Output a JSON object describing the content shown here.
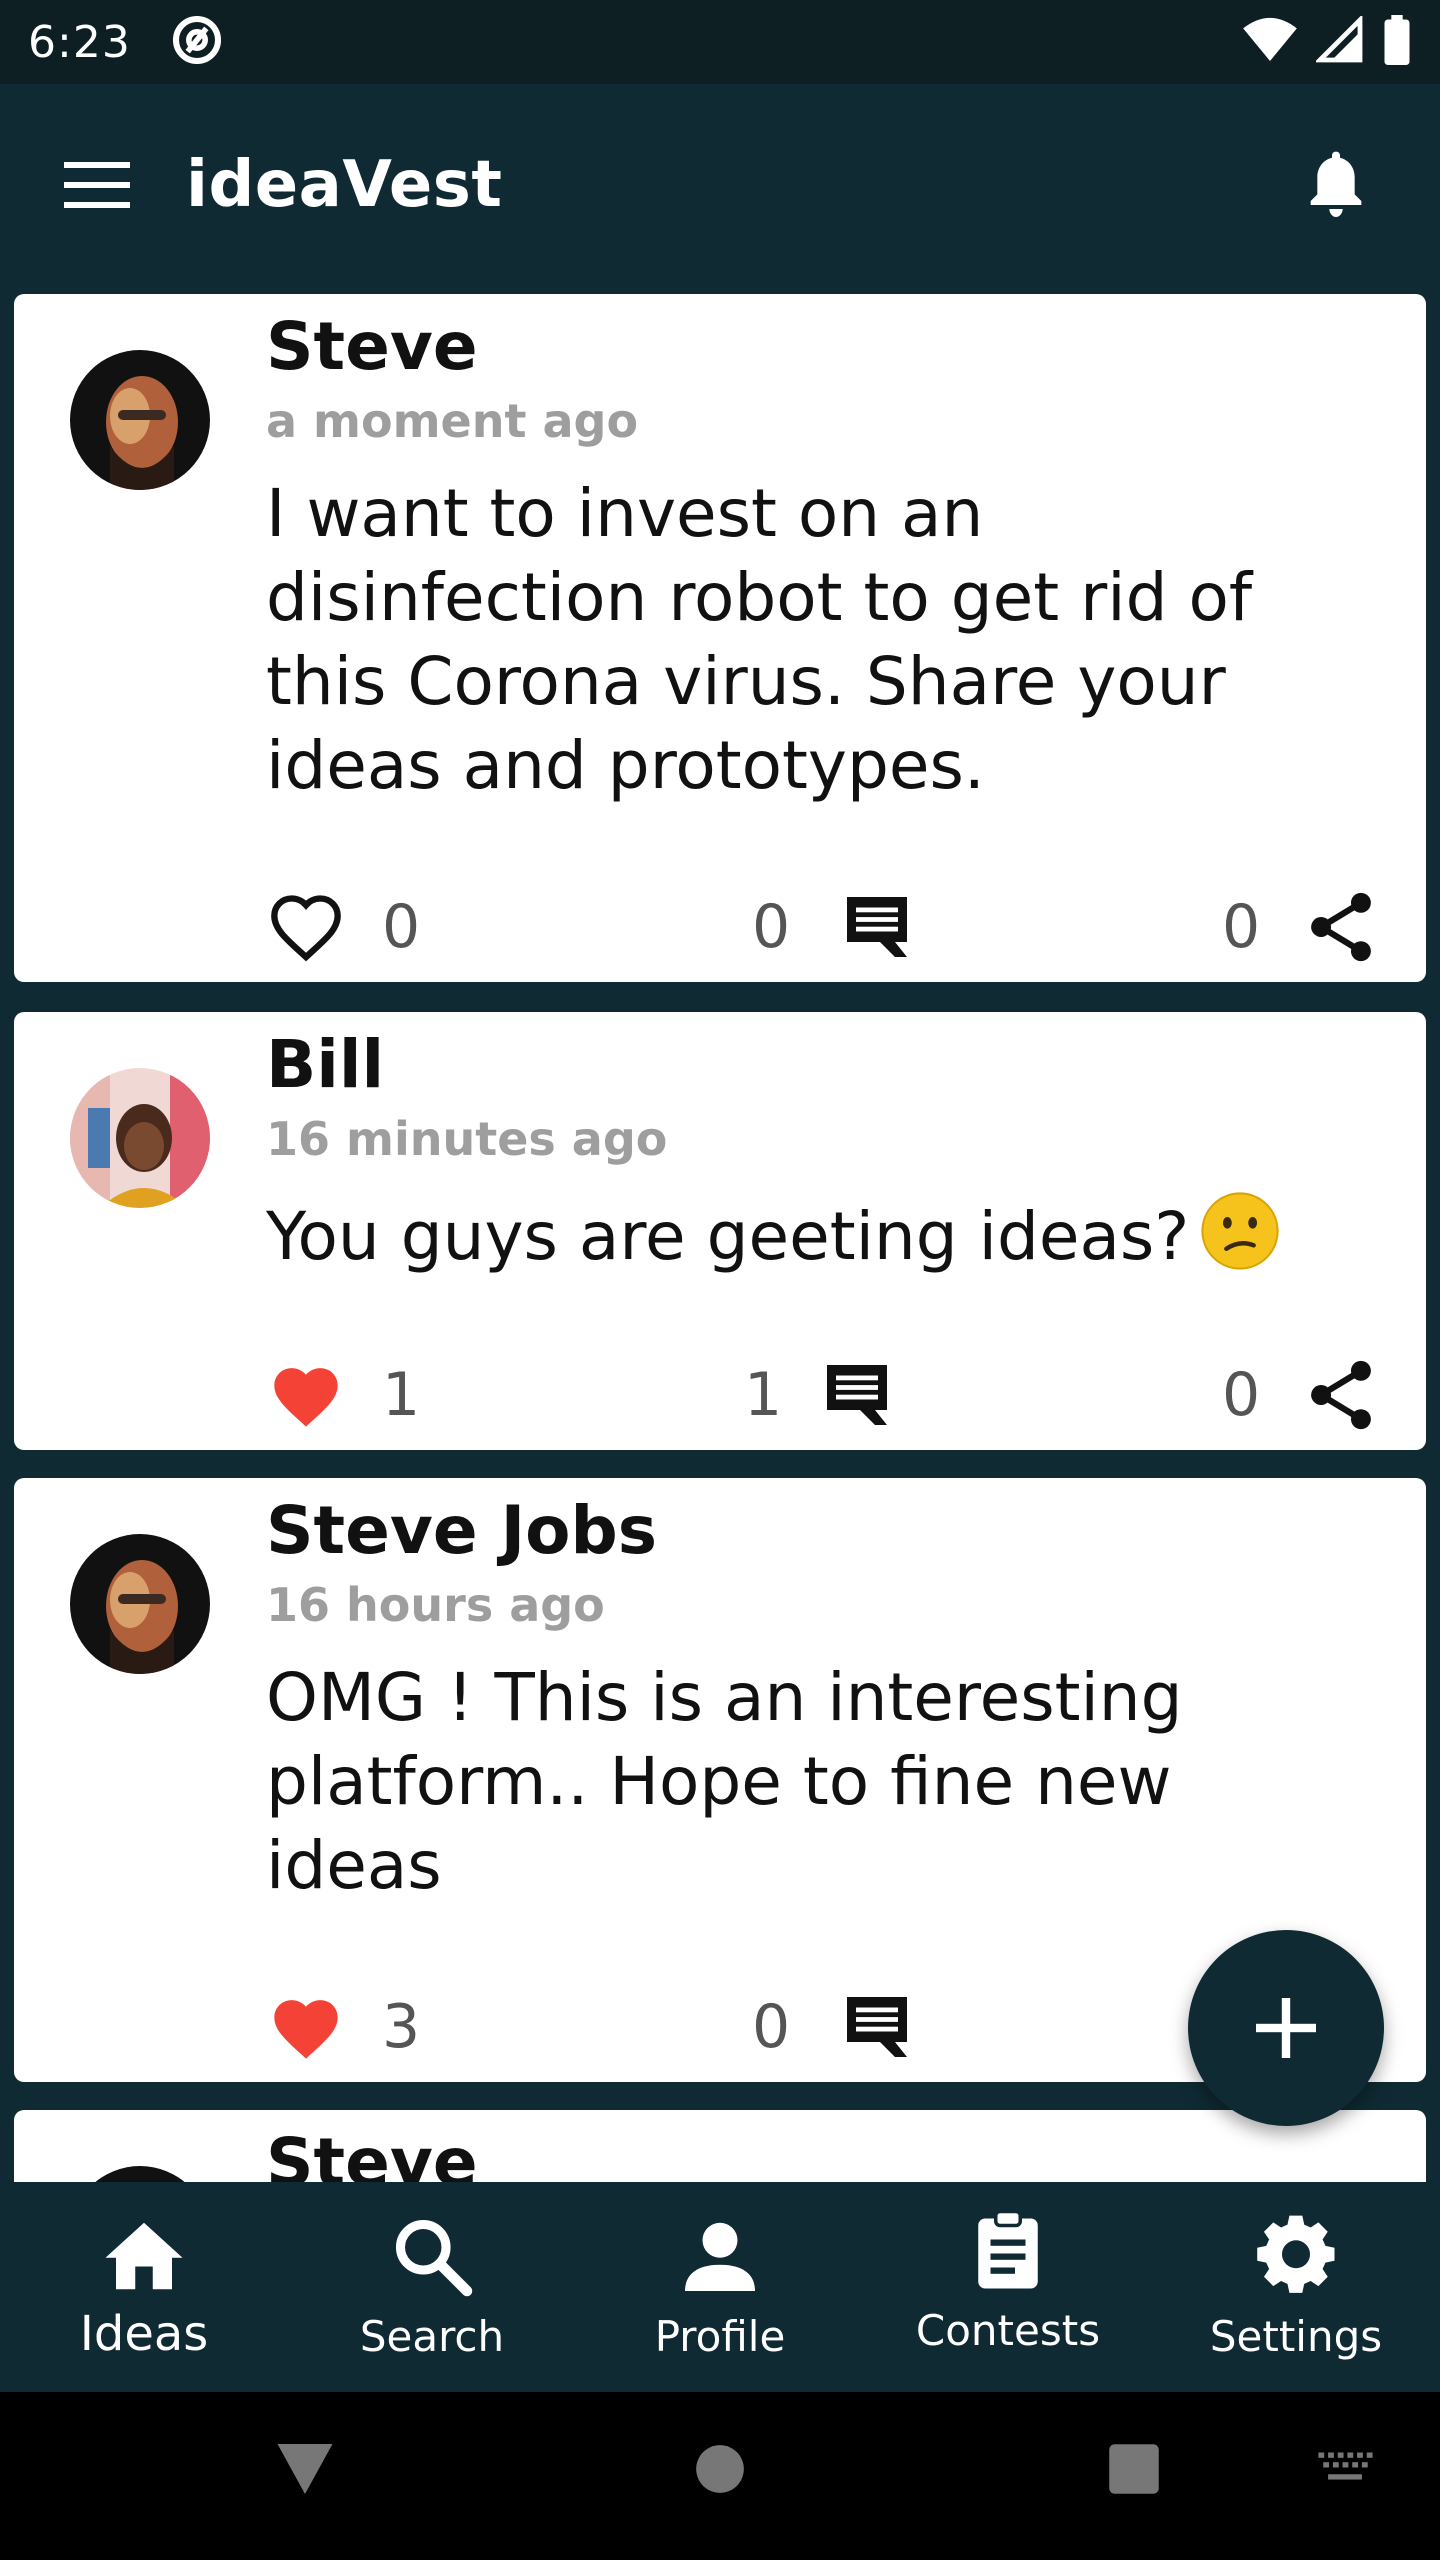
{
  "status_bar": {
    "time": "6:23"
  },
  "app_bar": {
    "title": "ideaVest"
  },
  "posts": [
    {
      "author": "Steve",
      "time": "a moment ago",
      "text": "I want to invest on an disinfection robot to get rid of this Corona virus. Share your ideas and prototypes.",
      "likes": "0",
      "liked": false,
      "comments": "0",
      "shares": "0"
    },
    {
      "author": "Bill",
      "time": "16 minutes ago",
      "text": "You guys are geeting ideas?",
      "likes": "1",
      "liked": true,
      "comments": "1",
      "shares": "0"
    },
    {
      "author": "Steve Jobs",
      "time": "16 hours ago",
      "text": "OMG ! This is an interesting platform.. Hope to fine new ideas",
      "likes": "3",
      "liked": true,
      "comments": "0"
    },
    {
      "author": "Steve"
    }
  ],
  "bottom_nav": {
    "items": [
      {
        "label": "Ideas",
        "icon": "home-icon",
        "active": true
      },
      {
        "label": "Search",
        "icon": "search-icon"
      },
      {
        "label": "Profile",
        "icon": "person-icon"
      },
      {
        "label": "Contests",
        "icon": "clipboard-icon"
      },
      {
        "label": "Settings",
        "icon": "gear-icon"
      }
    ]
  },
  "colors": {
    "primary": "#0f2a33",
    "status_bar": "#0e1f24",
    "like_red": "#f44336",
    "muted": "#9e9e9e"
  }
}
